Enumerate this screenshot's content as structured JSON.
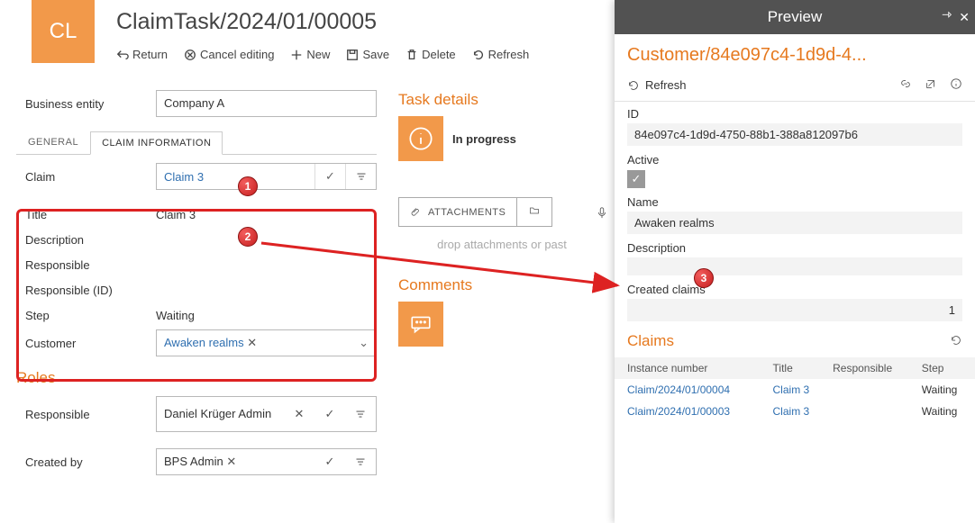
{
  "header": {
    "badge": "CL",
    "title": "ClaimTask/2024/01/00005",
    "toolbar": {
      "return": "Return",
      "cancel": "Cancel editing",
      "new": "New",
      "save": "Save",
      "delete": "Delete",
      "refresh": "Refresh"
    }
  },
  "left": {
    "business_entity_label": "Business entity",
    "business_entity_value": "Company A",
    "tabs": {
      "general": "GENERAL",
      "claim_info": "CLAIM INFORMATION"
    },
    "claim_label": "Claim",
    "claim_value": "Claim 3",
    "title_label": "Title",
    "title_value": "Claim 3",
    "description_label": "Description",
    "responsible_label": "Responsible",
    "responsible_id_label": "Responsible (ID)",
    "step_label": "Step",
    "step_value": "Waiting",
    "customer_label": "Customer",
    "customer_value": "Awaken realms",
    "roles_heading": "Roles",
    "role_responsible_label": "Responsible",
    "role_responsible_value": "Daniel Krüger Admin",
    "created_by_label": "Created by",
    "created_by_value": "BPS Admin"
  },
  "mid": {
    "task_details_heading": "Task details",
    "status": "In progress",
    "attachments_label": "ATTACHMENTS",
    "drop_hint": "drop attachments or past",
    "comments_heading": "Comments"
  },
  "preview": {
    "panel_title": "Preview",
    "entity_title": "Customer/84e097c4-1d9d-4...",
    "toolbar_refresh": "Refresh",
    "id_label": "ID",
    "id_value": "84e097c4-1d9d-4750-88b1-388a812097b6",
    "active_label": "Active",
    "name_label": "Name",
    "name_value": "Awaken realms",
    "description_label": "Description",
    "created_label": "Created claims",
    "created_count": "1",
    "claims_heading": "Claims",
    "cols": {
      "instance": "Instance number",
      "title": "Title",
      "responsible": "Responsible",
      "step": "Step"
    },
    "rows": [
      {
        "instance": "Claim/2024/01/00004",
        "title": "Claim 3",
        "responsible": "",
        "step": "Waiting"
      },
      {
        "instance": "Claim/2024/01/00003",
        "title": "Claim 3",
        "responsible": "",
        "step": "Waiting"
      }
    ]
  },
  "annotations": {
    "one": "1",
    "two": "2",
    "three": "3"
  }
}
